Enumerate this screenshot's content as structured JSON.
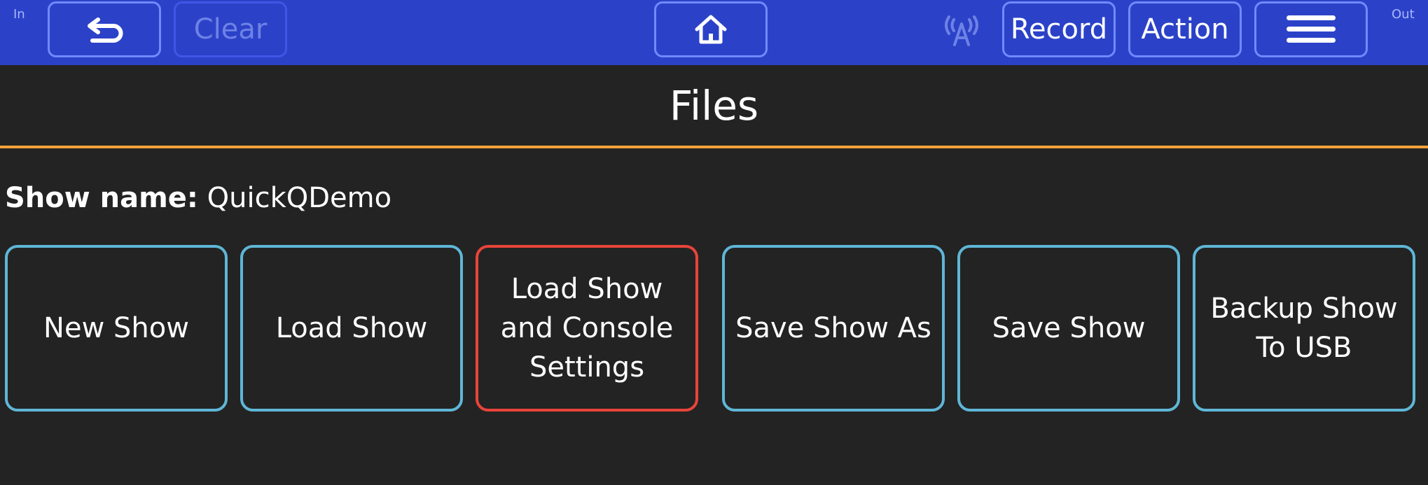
{
  "topbar": {
    "in_label": "In",
    "out_label": "Out",
    "undo_icon": "undo-arrow-icon",
    "clear_label": "Clear",
    "home_icon": "home-icon",
    "antenna_icon": "antenna-icon",
    "record_label": "Record",
    "action_label": "Action",
    "menu_icon": "hamburger-menu-icon",
    "colors": {
      "bar": "#2b42c8",
      "button_border": "#6f8bff",
      "disabled_text": "#6e82e6"
    }
  },
  "page": {
    "title": "Files",
    "accent_rule_color": "#f2a13a"
  },
  "show": {
    "name_label": "Show name:",
    "name_value": "QuickQDemo"
  },
  "actions": [
    {
      "label": "New Show",
      "border_color": "#5fb6d6"
    },
    {
      "label": "Load Show",
      "border_color": "#5fb6d6"
    },
    {
      "label": "Load Show and Console Settings",
      "border_color": "#e8443a"
    },
    {
      "label": "Save Show As",
      "border_color": "#5fb6d6"
    },
    {
      "label": "Save Show",
      "border_color": "#5fb6d6"
    },
    {
      "label": "Backup Show To USB",
      "border_color": "#5fb6d6"
    }
  ]
}
